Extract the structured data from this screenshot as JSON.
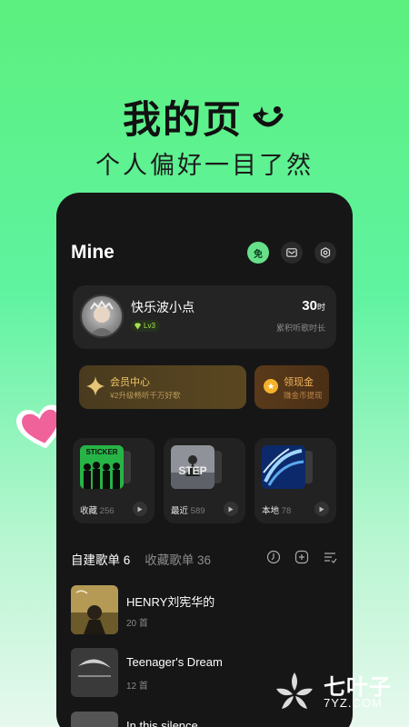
{
  "promo": {
    "title": "我的页",
    "subtitle": "个人偏好一目了然"
  },
  "header": {
    "title": "Mine",
    "free_icon_label": "免",
    "icons": [
      "free-icon",
      "mail-icon",
      "settings-icon"
    ]
  },
  "profile": {
    "username": "快乐波小点",
    "level": "Lv3",
    "listen_hours": "30",
    "listen_unit": "时",
    "listen_label": "累积听歌时长"
  },
  "vip": {
    "title": "会员中心",
    "subtitle": "¥2升级畅听千万好歌"
  },
  "cash": {
    "title": "领现金",
    "subtitle": "赚金币提现"
  },
  "quick_cards": [
    {
      "label": "收藏",
      "count": "256",
      "cover_text": "STICKER"
    },
    {
      "label": "最近",
      "count": "589",
      "cover_text": "STEP"
    },
    {
      "label": "本地",
      "count": "78",
      "cover_text": ""
    }
  ],
  "tabs": {
    "created_label": "自建歌单",
    "created_count": "6",
    "collected_label": "收藏歌单",
    "collected_count": "36"
  },
  "playlists": [
    {
      "name": "HENRY刘宪华的",
      "count": "20 首"
    },
    {
      "name": "Teenager's Dream",
      "count": "12 首"
    },
    {
      "name": "In this silence",
      "count": ""
    }
  ],
  "watermark": {
    "name": "七叶子",
    "url": "7YZ.COM"
  },
  "colors": {
    "accent_green": "#67e08a",
    "gold": "#f1c765",
    "background_dark": "#161616"
  }
}
